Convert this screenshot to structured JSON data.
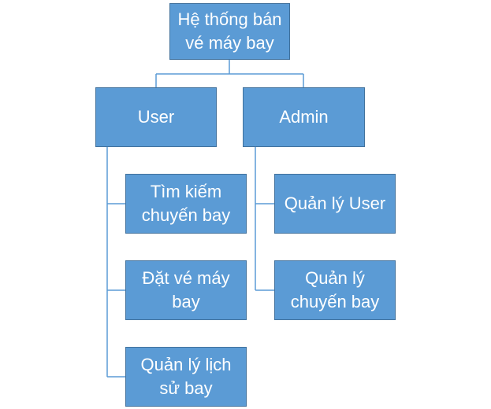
{
  "diagram": {
    "root": {
      "label": "Hệ thống bán\nvé máy bay"
    },
    "user": {
      "label": "User",
      "children": [
        {
          "label": "Tìm kiếm\nchuyến bay"
        },
        {
          "label": "Đặt vé máy\nbay"
        },
        {
          "label": "Quản lý lịch\nsử bay"
        }
      ]
    },
    "admin": {
      "label": "Admin",
      "children": [
        {
          "label": "Quản lý User"
        },
        {
          "label": "Quản lý\nchuyến bay"
        }
      ]
    }
  },
  "colors": {
    "node_fill": "#5b9bd5",
    "node_border": "#41719c",
    "connector": "#5b9bd5",
    "text": "#ffffff"
  }
}
